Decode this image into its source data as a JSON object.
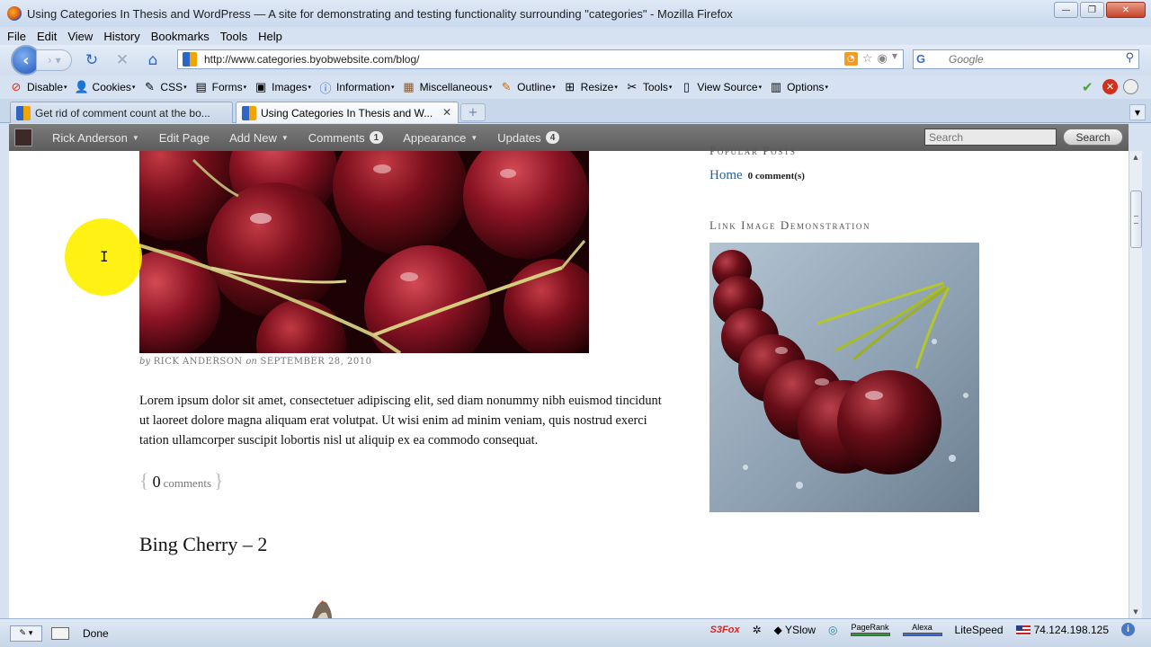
{
  "window": {
    "title": "Using Categories In Thesis and WordPress — A site for demonstrating and testing functionality surrounding \"categories\" - Mozilla Firefox"
  },
  "menubar": {
    "items": [
      "File",
      "Edit",
      "View",
      "History",
      "Bookmarks",
      "Tools",
      "Help"
    ]
  },
  "navbar": {
    "url": "http://www.categories.byobwebsite.com/blog/",
    "search_placeholder": "Google"
  },
  "devbar": {
    "items": [
      "Disable",
      "Cookies",
      "CSS",
      "Forms",
      "Images",
      "Information",
      "Miscellaneous",
      "Outline",
      "Resize",
      "Tools",
      "View Source",
      "Options"
    ]
  },
  "tabs": [
    {
      "label": "Get rid of comment count at the bo..."
    },
    {
      "label": "Using Categories In Thesis and W..."
    }
  ],
  "adminbar": {
    "user": "Rick Anderson",
    "edit_page": "Edit Page",
    "add_new": "Add New",
    "comments": "Comments",
    "comments_count": "1",
    "appearance": "Appearance",
    "updates": "Updates",
    "updates_count": "4",
    "search_placeholder": "Search",
    "search_button": "Search"
  },
  "post": {
    "by_prefix": "by",
    "author": "RICK ANDERSON",
    "on_word": "on",
    "date": "SEPTEMBER 28, 2010",
    "body": "Lorem ipsum dolor sit amet, consectetuer adipiscing elit, sed diam nonummy nibh euismod tincidunt ut laoreet dolore magna aliquam erat volutpat. Ut wisi enim ad minim veniam, quis nostrud exerci tation ullamcorper suscipit lobortis nisl ut aliquip ex ea commodo consequat.",
    "comment_brace_open": "{",
    "comment_count": "0",
    "comment_label": "comments",
    "comment_brace_close": "}",
    "next_title": "Bing Cherry – 2"
  },
  "sidebar": {
    "popular_heading": "Popular Posts",
    "popular_link": "Home",
    "popular_comments": "0 comment(s)",
    "link_image_heading": "Link Image Demonstration"
  },
  "statusbar": {
    "status": "Done",
    "s3fox_a": "S3",
    "s3fox_b": "Fox",
    "yslow": "YSlow",
    "pagerank": "PageRank",
    "alexa": "Alexa",
    "litespeed": "LiteSpeed",
    "ip": "74.124.198.125"
  },
  "colors": {
    "link": "#2361a1",
    "adminbar": "#6a6a6a",
    "cursor_highlight": "#fff000"
  }
}
